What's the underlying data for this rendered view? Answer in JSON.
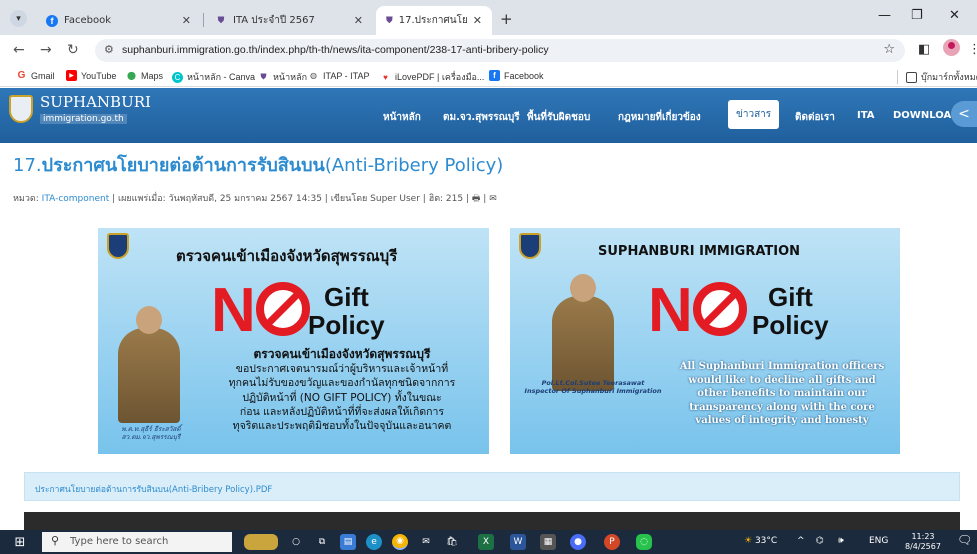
{
  "browser": {
    "tabs": [
      {
        "title": "Facebook",
        "icon": "facebook-icon"
      },
      {
        "title": "ITA ประจำปี 2567",
        "icon": "site-shield-icon"
      },
      {
        "title": "17.ประกาศนโยบายต่อต้านการรับสินบ",
        "icon": "site-shield-icon",
        "active": true
      }
    ],
    "url": "suphanburi.immigration.go.th/index.php/th-th/news/ita-component/238-17-anti-bribery-policy",
    "bookmarks": [
      "Gmail",
      "YouTube",
      "Maps",
      "หน้าหลัก - Canva",
      "หน้าหลัก",
      "ITAP - ITAP",
      "iLovePDF | เครื่องมือ...",
      "Facebook"
    ],
    "all_bookmarks": "บุ๊กมาร์กทั้งหมด"
  },
  "site": {
    "logo_title": "SUPHANBURI",
    "logo_subtitle": "immigration.go.th",
    "menu": [
      "หน้าหลัก",
      "ตม.จว.สุพรรณบุรี",
      "พื้นที่รับผิดชอบ",
      "กฎหมายที่เกี่ยวข้อง",
      "ข่าวสาร",
      "ติดต่อเรา",
      "ITA",
      "DOWNLOA"
    ],
    "active_menu": "ข่าวสาร"
  },
  "article": {
    "title_number": "17.",
    "title_th": "ประกาศนโยบายต่อต้านการรับสินบน",
    "title_en": "(Anti-Bribery Policy)",
    "meta_category_label": "หมวด:",
    "meta_category": "ITA-component",
    "meta_published": "เผยแพร่เมื่อ: วันพฤหัสบดี, 25 มกราคม 2567 14:35",
    "meta_author": "เขียนโดย Super User",
    "meta_hits": "ฮิต: 215",
    "attachment": "ประกาศนโยบายต่อต้านการรับสินบน(Anti-Bribery Policy).PDF"
  },
  "posters": {
    "th": {
      "title": "ตรวจคนเข้าเมืองจังหวัดสุพรรณบุรี",
      "no": "N",
      "gift": "Gift",
      "policy": "Policy",
      "body_title": "ตรวจคนเข้าเมืองจังหวัดสุพรรณบุรี",
      "body_lines": [
        "ขอประกาศเจตนารมณ์ว่าผู้บริหารและเจ้าหน้าที่",
        "ทุกคนไม่รับของขวัญและของกำนัลทุกชนิดจากการ",
        "ปฏิบัติหน้าที่ (NO GIFT POLICY) ทั้งในขณะ",
        "ก่อน และหลังปฏิบัติหน้าที่ที่จะส่งผลให้เกิดการ",
        "ทุจริตและประพฤติมิชอบทั้งในปัจจุบันและอนาคต"
      ],
      "caption_lines": [
        "พ.ต.ท.สุธีร์ ธีระสวัสดิ์",
        "สว.ตม.จว.สุพรรณบุรี"
      ]
    },
    "en": {
      "title": "SUPHANBURI IMMIGRATION",
      "no": "N",
      "gift": "Gift",
      "policy": "Policy",
      "body_lines": [
        "All Suphanburi Immigration officers",
        "would like to decline all gifts and",
        "other benefits to maintain our",
        "transparency along with the core",
        "values of integrity and honesty"
      ],
      "caption_lines": [
        "Pol.Lt.Col.Sutee Teerasawat",
        "Inspector Of Suphanburi Immigration"
      ]
    }
  },
  "taskbar": {
    "search_placeholder": "Type here to search",
    "weather": "33°C",
    "lang": "ENG",
    "time": "11:23",
    "date": "8/4/2567"
  },
  "colors": {
    "nav_bg": "#2f77b8",
    "title_blue": "#2d8bd0",
    "no_red": "#e31b23",
    "poster_bg": "#9ed5f2"
  }
}
